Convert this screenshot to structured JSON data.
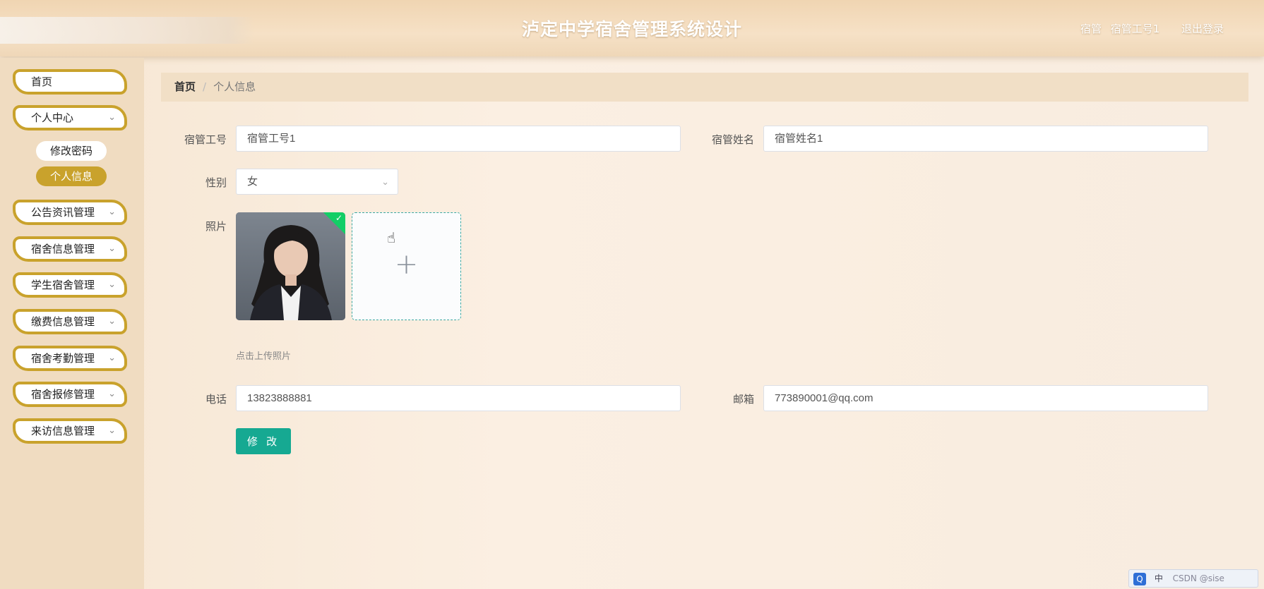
{
  "header": {
    "title": "泸定中学宿舍管理系统设计",
    "role": "宿管",
    "username": "宿管工号1",
    "logout_label": "退出登录"
  },
  "sidebar": {
    "items": [
      {
        "label": "首页"
      },
      {
        "label": "个人中心"
      },
      {
        "label": "公告资讯管理"
      },
      {
        "label": "宿舍信息管理"
      },
      {
        "label": "学生宿舍管理"
      },
      {
        "label": "缴费信息管理"
      },
      {
        "label": "宿舍考勤管理"
      },
      {
        "label": "宿舍报修管理"
      },
      {
        "label": "来访信息管理"
      }
    ],
    "subitems": [
      {
        "label": "修改密码"
      },
      {
        "label": "个人信息"
      }
    ]
  },
  "breadcrumb": {
    "home": "首页",
    "separator": "/",
    "current": "个人信息"
  },
  "form": {
    "staff_id": {
      "label": "宿管工号",
      "value": "宿管工号1"
    },
    "staff_name": {
      "label": "宿管姓名",
      "value": "宿管姓名1"
    },
    "gender": {
      "label": "性别",
      "value": "女"
    },
    "photo": {
      "label": "照片",
      "hint": "点击上传照片"
    },
    "phone": {
      "label": "电话",
      "value": "13823888881"
    },
    "email": {
      "label": "邮箱",
      "value": "773890001@qq.com"
    },
    "submit_label": "修 改"
  },
  "tray": {
    "ime": "中",
    "watermark": "CSDN @sise"
  },
  "colors": {
    "accent_gold": "#c9a22c",
    "button_teal": "#16a992",
    "success_green": "#13ce66"
  }
}
